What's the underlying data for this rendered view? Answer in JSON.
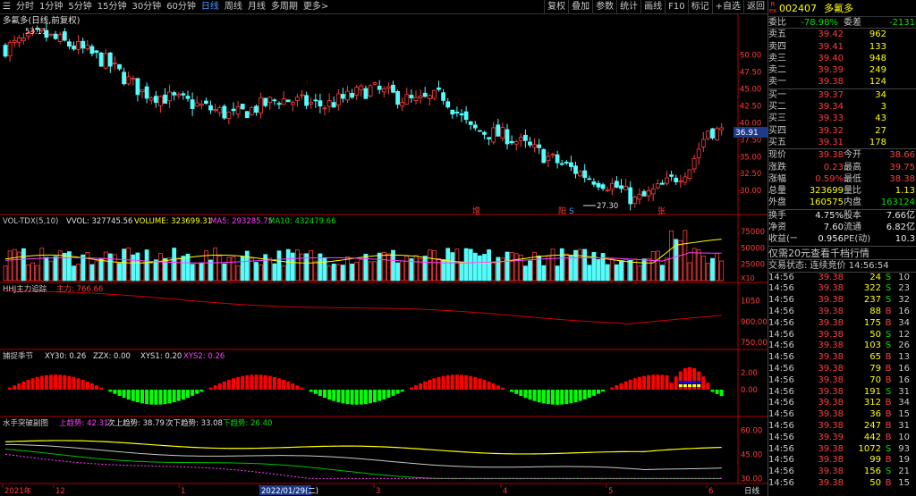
{
  "toolbar": {
    "periods": [
      "分时",
      "1分钟",
      "5分钟",
      "15分钟",
      "30分钟",
      "60分钟",
      "日线",
      "周线",
      "月线",
      "多周期",
      "更多>"
    ],
    "active_period": "日线",
    "right_buttons": [
      "复权",
      "叠加",
      "参数",
      "统计",
      "画线",
      "F10",
      "标记",
      "+自选",
      "返回"
    ]
  },
  "main_chart": {
    "title": "多氟多(日线,前复权)",
    "price_ticks": [
      "50.00",
      "47.50",
      "45.00",
      "42.50",
      "40.00",
      "37.50",
      "35.00",
      "32.50",
      "30.00"
    ],
    "high_label": "53.11",
    "low_label": "27.30",
    "current_price_tag": "36.91",
    "markers": [
      "增",
      "阳",
      "S",
      "张"
    ]
  },
  "vol_chart": {
    "title": "VOL-TDX(5,10)",
    "vvol": "VVOL: 327745.56",
    "volume": "VOLUME: 323699.31",
    "ma5": "MA5: 293285.75",
    "ma10": "MA10: 432479.66",
    "ticks": [
      "75000",
      "50000",
      "25000",
      "X10"
    ]
  },
  "hh_chart": {
    "title": "HHJ主力追踪",
    "value": "主力: 766.66",
    "ticks": [
      "1050",
      "900.00",
      "750.00"
    ]
  },
  "bs_chart": {
    "title": "捕捉季节",
    "xy30": "XY30: 0.26",
    "zzx": "ZZX: 0.00",
    "xys1": "XYS1: 0.20",
    "xys2": "XYS2: 0.26",
    "ticks": [
      "2.00",
      "0.00"
    ]
  },
  "sx_chart": {
    "title": "水手突破副图",
    "l1": "上趋势: 42.31",
    "l2": "次上趋势: 38.79",
    "l3": "次下趋势: 33.08",
    "l4": "下趋势: 26.40",
    "ticks": [
      "60.00",
      "45.00",
      "30.00"
    ]
  },
  "date_axis": {
    "labels": [
      "2021年",
      "12",
      "1",
      "2022/01/29(二)",
      "3",
      "4",
      "5",
      "6"
    ],
    "right_label": "日线"
  },
  "panel": {
    "code": "002407",
    "name": "多氟多",
    "ratio_label": "委比",
    "ratio_value": "-78.98%",
    "diff_label": "委差",
    "diff_value": "-2131",
    "asks": [
      {
        "label": "卖五",
        "price": "39.42",
        "vol": "962"
      },
      {
        "label": "卖四",
        "price": "39.41",
        "vol": "133"
      },
      {
        "label": "卖三",
        "price": "39.40",
        "vol": "948"
      },
      {
        "label": "卖二",
        "price": "39.39",
        "vol": "249"
      },
      {
        "label": "卖一",
        "price": "39.38",
        "vol": "124"
      }
    ],
    "bids": [
      {
        "label": "买一",
        "price": "39.37",
        "vol": "34"
      },
      {
        "label": "买二",
        "price": "39.34",
        "vol": "3"
      },
      {
        "label": "买三",
        "price": "39.33",
        "vol": "43"
      },
      {
        "label": "买四",
        "price": "39.32",
        "vol": "27"
      },
      {
        "label": "买五",
        "price": "39.31",
        "vol": "178"
      }
    ],
    "stats": [
      {
        "l1": "现价",
        "v1": "39.38",
        "l2": "今开",
        "v2": "38.66"
      },
      {
        "l1": "涨跌",
        "v1": "0.23",
        "l2": "最高",
        "v2": "39.75"
      },
      {
        "l1": "涨幅",
        "v1": "0.59%",
        "l2": "最低",
        "v2": "38.38"
      },
      {
        "l1": "总量",
        "v1": "323699",
        "l2": "量比",
        "v2": "1.13"
      },
      {
        "l1": "外盘",
        "v1": "160575",
        "l2": "内盘",
        "v2": "163124"
      }
    ],
    "stats2": [
      {
        "l1": "换手",
        "v1": "4.75%",
        "l2": "股本",
        "v2": "7.66亿"
      },
      {
        "l1": "净资",
        "v1": "7.60",
        "l2": "流通",
        "v2": "6.82亿"
      },
      {
        "l1": "收益(一)",
        "v1": "0.956",
        "l2": "PE(动)",
        "v2": "10.3"
      }
    ],
    "notice": "仅需20元查看千档行情",
    "trade_state": "交易状态: 连续竞价 14:56:54",
    "ticks": [
      {
        "t": "14:56",
        "p": "39.38",
        "v": "24",
        "s": "S",
        "n": "10"
      },
      {
        "t": "14:56",
        "p": "39.38",
        "v": "322",
        "s": "S",
        "n": "23"
      },
      {
        "t": "14:56",
        "p": "39.38",
        "v": "237",
        "s": "S",
        "n": "32"
      },
      {
        "t": "14:56",
        "p": "39.38",
        "v": "88",
        "s": "B",
        "n": "16"
      },
      {
        "t": "14:56",
        "p": "39.38",
        "v": "175",
        "s": "B",
        "n": "34"
      },
      {
        "t": "14:56",
        "p": "39.38",
        "v": "50",
        "s": "S",
        "n": "12"
      },
      {
        "t": "14:56",
        "p": "39.38",
        "v": "103",
        "s": "S",
        "n": "26"
      },
      {
        "t": "14:56",
        "p": "39.38",
        "v": "65",
        "s": "B",
        "n": "13"
      },
      {
        "t": "14:56",
        "p": "39.38",
        "v": "79",
        "s": "B",
        "n": "16"
      },
      {
        "t": "14:56",
        "p": "39.38",
        "v": "70",
        "s": "B",
        "n": "16"
      },
      {
        "t": "14:56",
        "p": "39.38",
        "v": "191",
        "s": "S",
        "n": "31"
      },
      {
        "t": "14:56",
        "p": "39.38",
        "v": "312",
        "s": "B",
        "n": "34"
      },
      {
        "t": "14:56",
        "p": "39.38",
        "v": "36",
        "s": "B",
        "n": "15"
      },
      {
        "t": "14:56",
        "p": "39.38",
        "v": "247",
        "s": "B",
        "n": "31"
      },
      {
        "t": "14:56",
        "p": "39.39",
        "v": "442",
        "s": "B",
        "n": "10"
      },
      {
        "t": "14:56",
        "p": "39.38",
        "v": "1072",
        "s": "S",
        "n": "93"
      },
      {
        "t": "14:56",
        "p": "39.38",
        "v": "99",
        "s": "B",
        "n": "19"
      },
      {
        "t": "14:56",
        "p": "39.38",
        "v": "156",
        "s": "S",
        "n": "21"
      },
      {
        "t": "14:56",
        "p": "39.38",
        "v": "50",
        "s": "B",
        "n": "15"
      }
    ]
  }
}
